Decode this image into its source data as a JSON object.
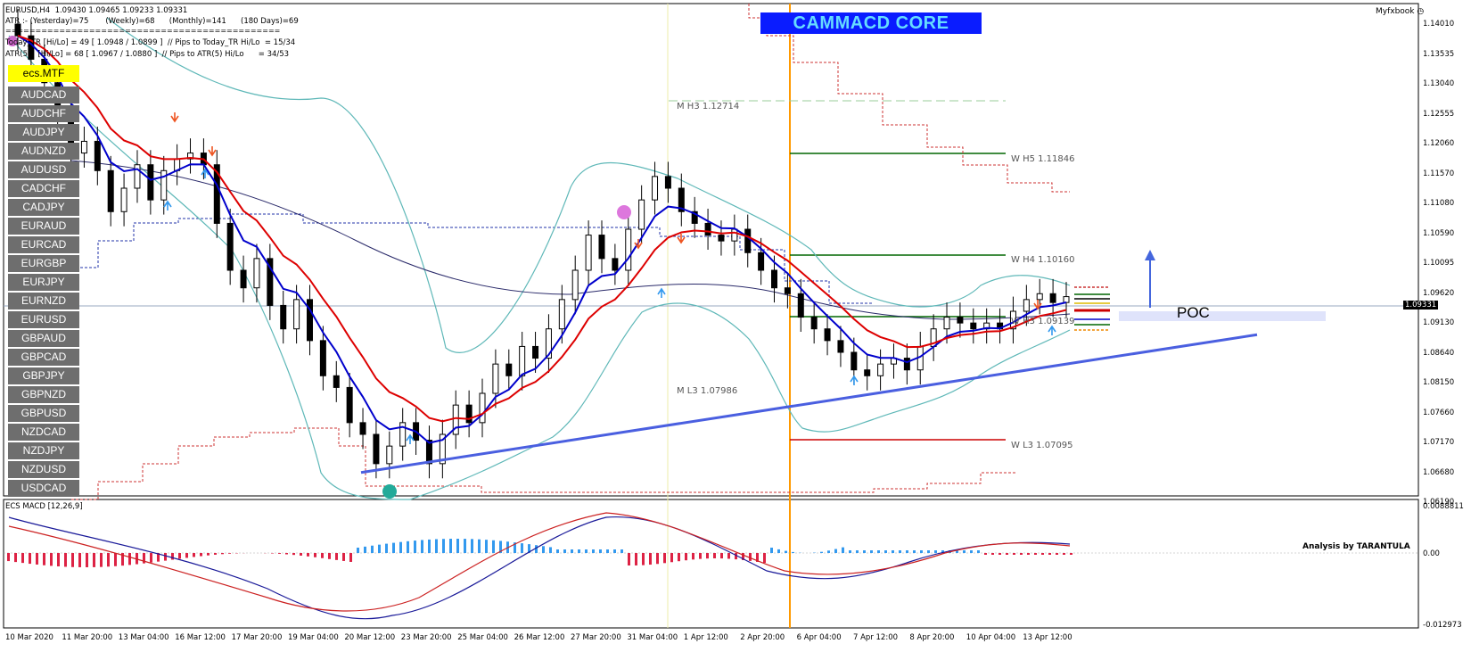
{
  "header": {
    "symbol_line": "EURUSD,H4  1.09430 1.09465 1.09233 1.09331",
    "atr_line": "ATR :- (Yesterday)=75       (Weekly)=68      (Monthly)=141      (180 Days)=69",
    "separator": "==============================================",
    "today_line": "Today_TR [Hi/Lo] = 49 [ 1.0948 / 1.0899 ]  // Pips to Today_TR Hi/Lo  = 15/34",
    "atr5_line": "ATR(5)   [Hi/Lo] = 68 [ 1.0967 / 1.0880 ]  // Pips to ATR(5) Hi/Lo      = 34/53"
  },
  "indicator_title": "CAMMACD CORE",
  "brand": "Myfxbook",
  "mtf_label": "ecs.MTF",
  "symbols": [
    "AUDCAD",
    "AUDCHF",
    "AUDJPY",
    "AUDNZD",
    "AUDUSD",
    "CADCHF",
    "CADJPY",
    "EURAUD",
    "EURCAD",
    "EURGBP",
    "EURJPY",
    "EURNZD",
    "EURUSD",
    "GBPAUD",
    "GBPCAD",
    "GBPJPY",
    "GBPNZD",
    "GBPUSD",
    "NZDCAD",
    "NZDJPY",
    "NZDUSD",
    "USDCAD"
  ],
  "levels": {
    "m_h3": "M  H3 1.12714",
    "w_h5": "W  H5 1.11846",
    "w_h4": "W  H4 1.10160",
    "w_h3": "W  H3 1.09139",
    "m_l3": "M  L3 1.07986",
    "w_l3": "W  L3 1.07095"
  },
  "poc_label": "POC",
  "analysis_credit": "Analysis by TARANTULA",
  "current_price": "1.09331",
  "macd_label": "ECS MACD [12,26,9]",
  "colors": {
    "bull_candle": "#ffffff",
    "bear_candle": "#000000",
    "ema_fast": "#0000cc",
    "ema_slow": "#dd0000",
    "bollinger": "#5fb8b8",
    "trendline": "#4a5fe0",
    "vertical_marker": "#ff9900",
    "macd_positive": "#3399ee",
    "macd_negative": "#dd2244"
  },
  "chart_data": {
    "type": "candlestick",
    "title": "EURUSD,H4",
    "ylim": [
      1.0595,
      1.1435
    ],
    "y_ticks": [
      "1.14010",
      "1.13535",
      "1.13040",
      "1.12555",
      "1.12060",
      "1.11570",
      "1.11080",
      "1.10590",
      "1.10095",
      "1.09620",
      "1.09130",
      "1.08640",
      "1.08150",
      "1.07660",
      "1.07170",
      "1.06680",
      "1.06190"
    ],
    "x_ticks": [
      "10 Mar 2020",
      "11 Mar 20:00",
      "13 Mar 04:00",
      "16 Mar 12:00",
      "17 Mar 20:00",
      "19 Mar 04:00",
      "20 Mar 12:00",
      "23 Mar 20:00",
      "25 Mar 04:00",
      "26 Mar 12:00",
      "27 Mar 20:00",
      "31 Mar 04:00",
      "1 Apr 12:00",
      "2 Apr 20:00",
      "6 Apr 04:00",
      "7 Apr 12:00",
      "8 Apr 20:00",
      "10 Apr 04:00",
      "13 Apr 12:00"
    ],
    "close": [
      1.138,
      1.134,
      1.13,
      1.125,
      1.118,
      1.12,
      1.115,
      1.108,
      1.112,
      1.116,
      1.11,
      1.115,
      1.117,
      1.118,
      1.116,
      1.106,
      1.098,
      1.095,
      1.1,
      1.092,
      1.088,
      1.093,
      1.086,
      1.08,
      1.078,
      1.072,
      1.07,
      1.065,
      1.068,
      1.072,
      1.069,
      1.065,
      1.07,
      1.075,
      1.072,
      1.077,
      1.082,
      1.08,
      1.085,
      1.083,
      1.088,
      1.093,
      1.098,
      1.104,
      1.1,
      1.098,
      1.105,
      1.11,
      1.114,
      1.112,
      1.108,
      1.106,
      1.104,
      1.103,
      1.105,
      1.101,
      1.098,
      1.095,
      1.094,
      1.09,
      1.088,
      1.086,
      1.084,
      1.081,
      1.08,
      1.082,
      1.083,
      1.081,
      1.085,
      1.088,
      1.09,
      1.089,
      1.088,
      1.089,
      1.088,
      1.091,
      1.093,
      1.094,
      1.0925,
      1.0935
    ],
    "ema_fast_end": 1.093,
    "ema_slow_end": 1.0925,
    "macd_range": [
      -0.012973,
      0.008881
    ],
    "macd_ticks": [
      "0.0088811",
      "0.00",
      "-0.012973"
    ],
    "trendline": {
      "from": 1.0635,
      "to": 1.087
    },
    "bollinger_band_note": ""
  }
}
